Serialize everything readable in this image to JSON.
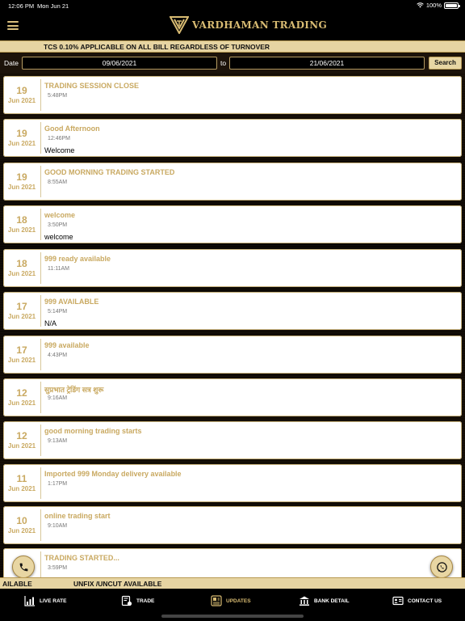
{
  "status_bar": {
    "time": "12:06 PM",
    "date": "Mon Jun 21",
    "battery": "100%"
  },
  "header": {
    "brand": "VARDHAMAN TRADING"
  },
  "ticker": {
    "text": "TCS 0.10% APPLICABLE ON ALL BILL REGARDLESS OF TURNOVER"
  },
  "filter": {
    "date_label": "Date",
    "from_date": "09/06/2021",
    "to_label": "to",
    "to_date": "21/06/2021",
    "search_label": "Search"
  },
  "updates": [
    {
      "day": "19",
      "month": "Jun 2021",
      "title": "TRADING SESSION CLOSE",
      "time": "5:48PM",
      "message": ""
    },
    {
      "day": "19",
      "month": "Jun 2021",
      "title": "Good Afternoon",
      "time": "12:46PM",
      "message": "Welcome"
    },
    {
      "day": "19",
      "month": "Jun 2021",
      "title": "GOOD MORNING TRADING STARTED",
      "time": "8:55AM",
      "message": ""
    },
    {
      "day": "18",
      "month": "Jun 2021",
      "title": "welcome",
      "time": "3:50PM",
      "message": "welcome"
    },
    {
      "day": "18",
      "month": "Jun 2021",
      "title": "999 ready available",
      "time": "11:11AM",
      "message": ""
    },
    {
      "day": "17",
      "month": "Jun 2021",
      "title": "999 AVAILABLE",
      "time": "5:14PM",
      "message": "N/A"
    },
    {
      "day": "17",
      "month": "Jun 2021",
      "title": "999 available",
      "time": "4:43PM",
      "message": ""
    },
    {
      "day": "12",
      "month": "Jun 2021",
      "title": "सुप्रभात ट्रेडिंग सत्र शुरू",
      "time": "9:16AM",
      "message": ""
    },
    {
      "day": "12",
      "month": "Jun 2021",
      "title": "good morning trading starts",
      "time": "9:13AM",
      "message": ""
    },
    {
      "day": "11",
      "month": "Jun 2021",
      "title": "Imported 999 Monday delivery available",
      "time": "1:17PM",
      "message": ""
    },
    {
      "day": "10",
      "month": "Jun 2021",
      "title": "online trading start",
      "time": "9:10AM",
      "message": ""
    },
    {
      "day": "",
      "month": "",
      "title": "TRADING STARTED...",
      "time": "3:59PM",
      "message": ""
    }
  ],
  "bottom_ticker": {
    "text_left": "AILABLE",
    "text_right": "UNFIX /UNCUT AVAILABLE"
  },
  "tabs": [
    {
      "label": "LIVE RATE",
      "icon": "chart-icon"
    },
    {
      "label": "TRADE",
      "icon": "trade-icon"
    },
    {
      "label": "UPDATES",
      "icon": "updates-icon",
      "active": true
    },
    {
      "label": "BANK DETAIL",
      "icon": "bank-icon"
    },
    {
      "label": "CONTACT US",
      "icon": "contact-icon"
    }
  ],
  "colors": {
    "accent_gold": "#c9a961",
    "ticker_bg": "#e6d4a2",
    "header_bg": "#000000"
  }
}
